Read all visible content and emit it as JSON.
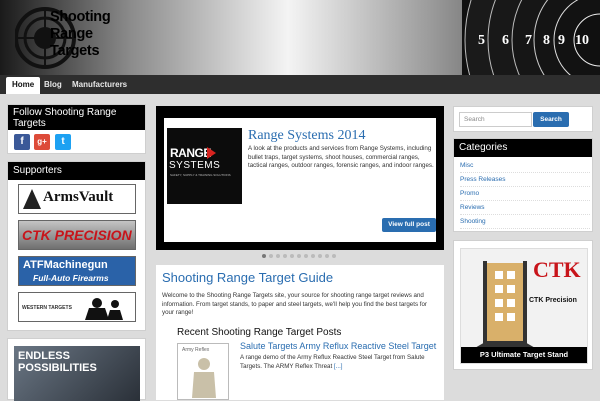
{
  "site": {
    "title_line1": "Shooting",
    "title_line2": "Range",
    "title_line3": "Targets",
    "ring_numbers": [
      "5",
      "6",
      "7",
      "8",
      "9",
      "10"
    ]
  },
  "nav": {
    "items": [
      {
        "label": "Home",
        "active": true
      },
      {
        "label": "Blog",
        "active": false
      },
      {
        "label": "Manufacturers",
        "active": false
      }
    ]
  },
  "left_sidebar": {
    "follow_title": "Follow Shooting Range Targets",
    "social": [
      {
        "name": "facebook-icon",
        "glyph": "f",
        "color": "#3b5998"
      },
      {
        "name": "google-plus-icon",
        "glyph": "g+",
        "color": "#dd4b39"
      },
      {
        "name": "twitter-icon",
        "glyph": "t",
        "color": "#1da1f2"
      }
    ],
    "supporters_title": "Supporters",
    "supporters": [
      {
        "name": "ArmsVault"
      },
      {
        "name": "CTK PRECISION"
      },
      {
        "name_line1": "ATFMachinegun",
        "name_line2": "Full-Auto Firearms"
      },
      {
        "name": "WESTERN TARGETS"
      }
    ],
    "banner_line1": "ENDLESS",
    "banner_line2": "POSSIBILITIES"
  },
  "slider": {
    "image_brand": "RANGE",
    "image_brand2": "SYSTEMS",
    "image_tagline": "SAFETY, SUPPLY & TRAINING SOLUTIONS",
    "title": "Range Systems 2014",
    "body": "A look at the products and services from Range Systems, including bullet traps, target systems, shoot houses, commercial ranges, tactical ranges, outdoor ranges, forensic ranges, and indoor ranges.",
    "button": "View full post"
  },
  "content": {
    "heading": "Shooting Range Target Guide",
    "intro": "Welcome to the Shooting Range Targets site, your source for shooting range target reviews and information. From target stands, to paper and steel targets, we'll help you find the best targets for your range!",
    "recent_heading": "Recent Shooting Range Target Posts",
    "post_title": "Salute Targets Army Reflux Reactive Steel Target",
    "post_excerpt": "A range demo of the Army Reflux Reactive Steel Target from Salute Targets. The ARMY Reflex Threat",
    "post_more": "[...]",
    "thumb_caption": "Army Reflex"
  },
  "right_sidebar": {
    "search_placeholder": "Search",
    "search_button": "Search",
    "categories_title": "Categories",
    "categories": [
      "Misc",
      "Press Releases",
      "Promo",
      "Reviews",
      "Shooting"
    ],
    "ad_brand": "CTK Precision",
    "ad_logo": "CTK",
    "ad_caption": "P3 Ultimate Target Stand"
  },
  "colors": {
    "link": "#2a6db0",
    "widget_title_bg": "#000000",
    "nav_bg": "#2e2e2e"
  }
}
